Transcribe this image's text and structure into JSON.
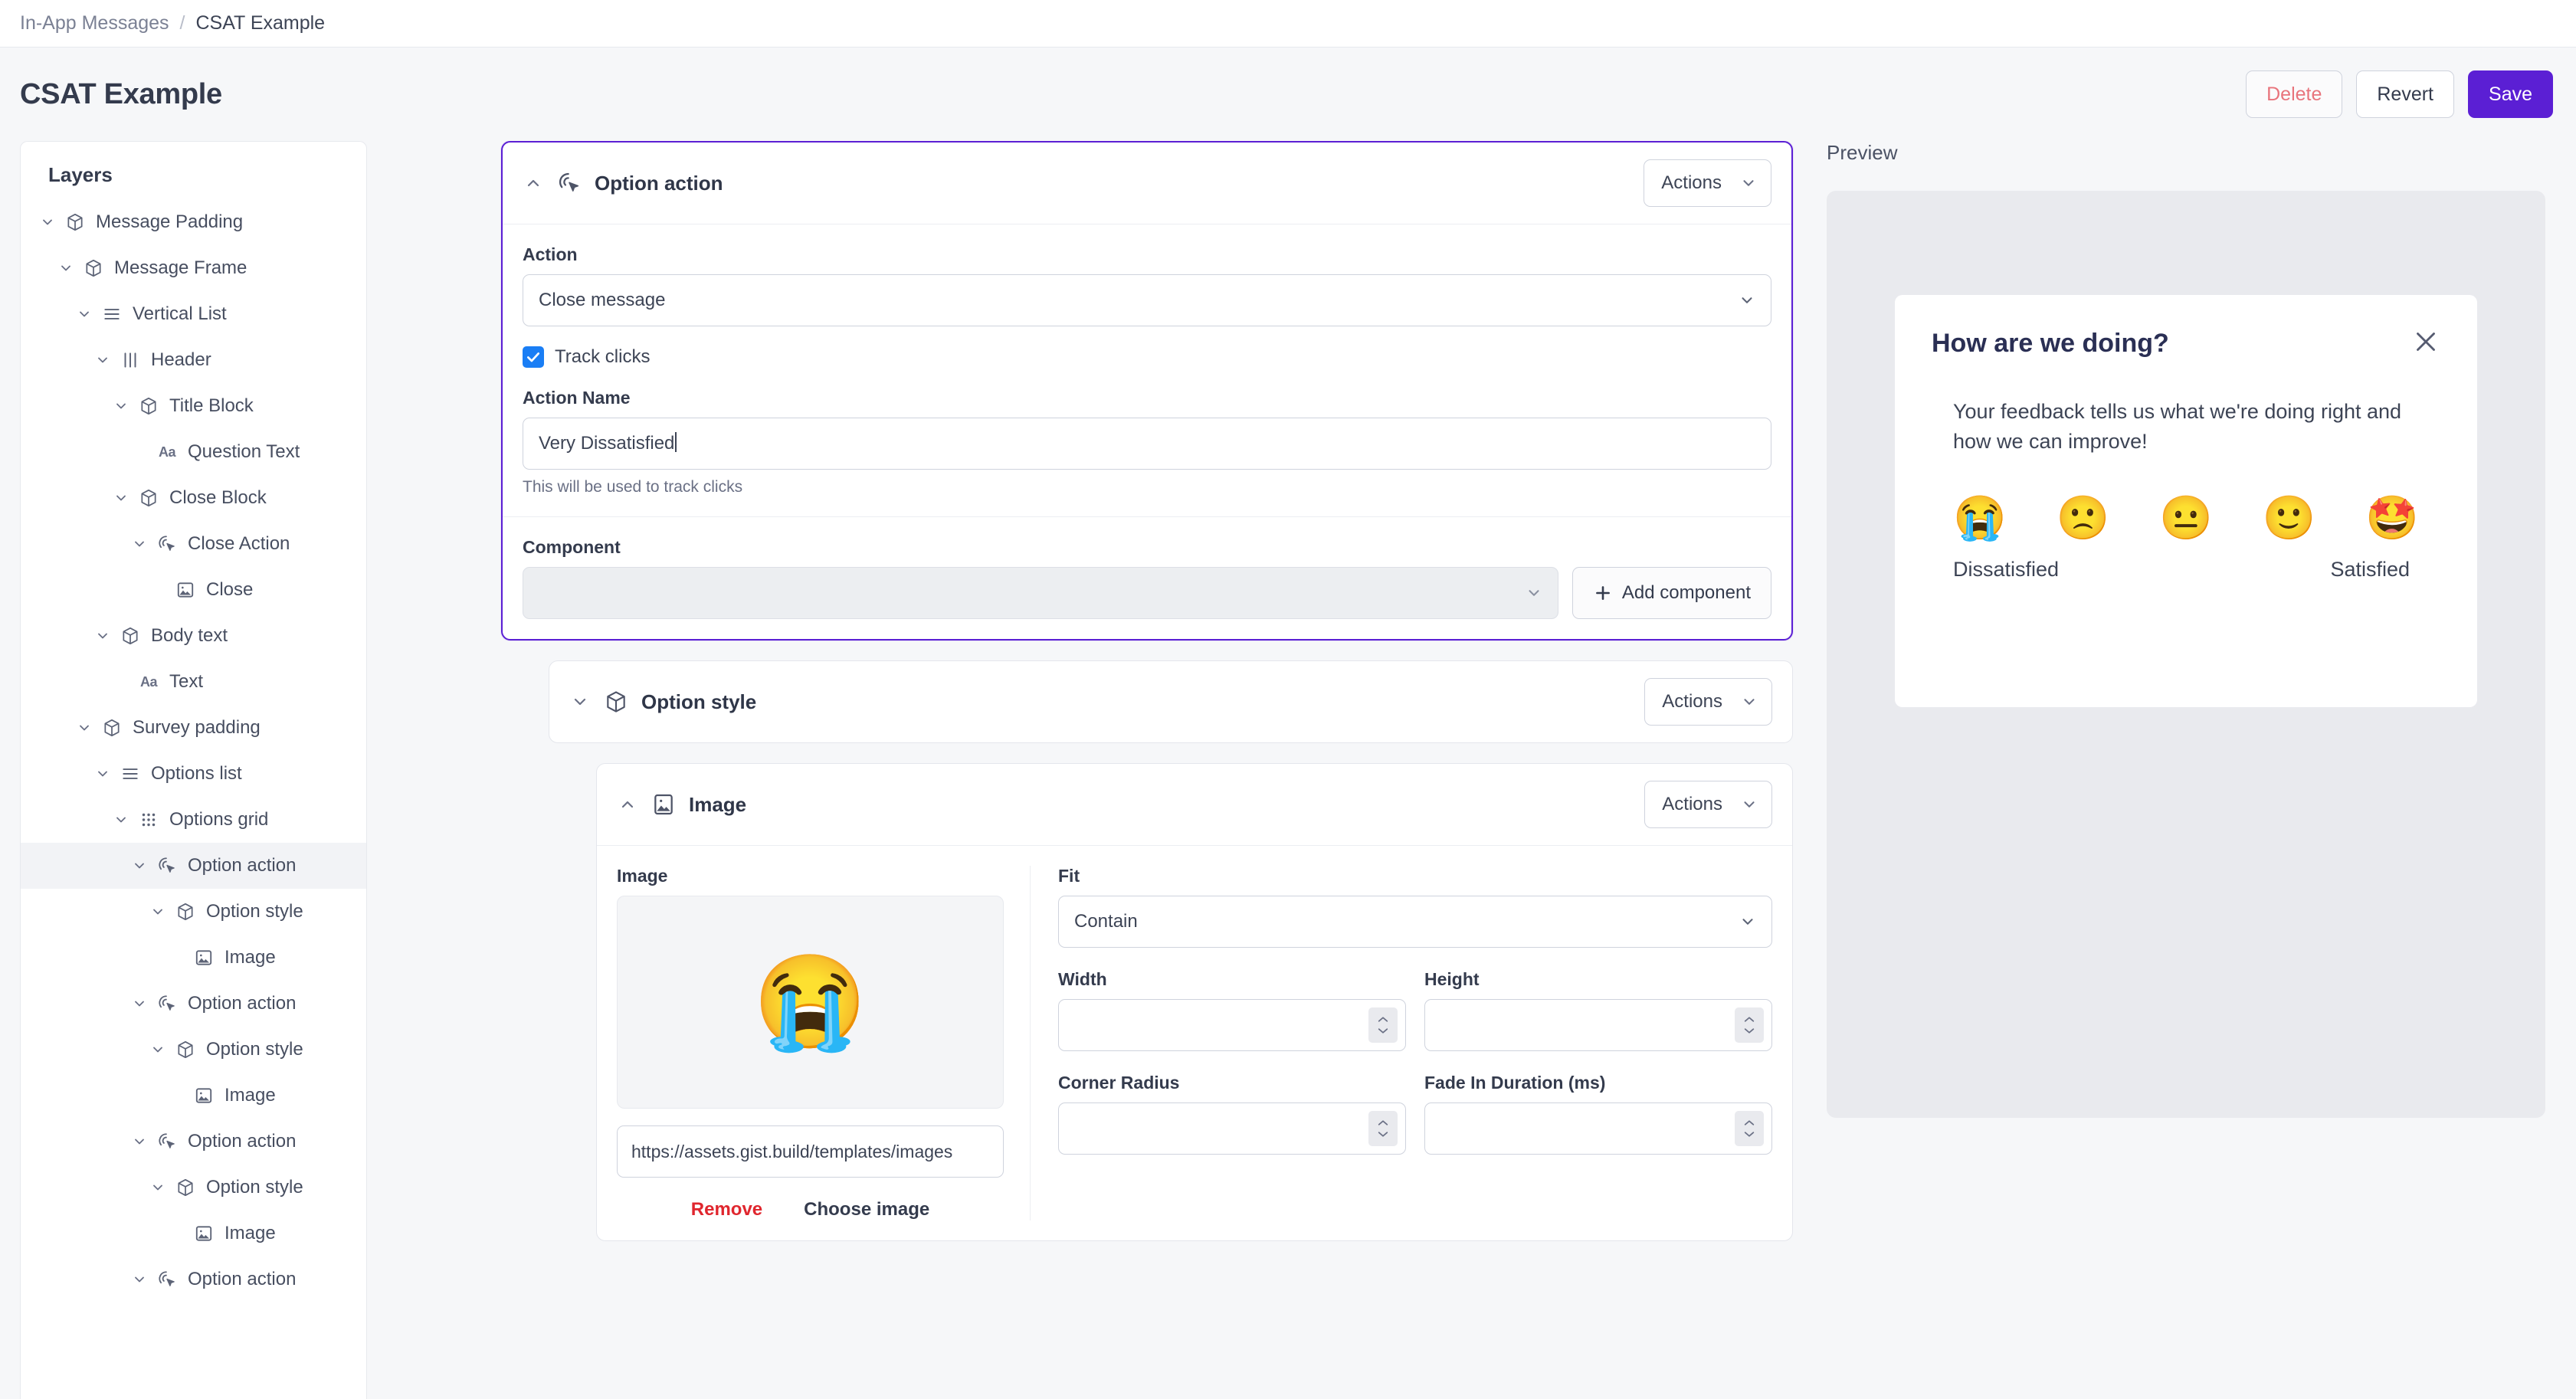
{
  "breadcrumb": {
    "parent": "In-App Messages",
    "separator": "/",
    "current": "CSAT Example"
  },
  "header": {
    "title": "CSAT Example",
    "delete_label": "Delete",
    "revert_label": "Revert",
    "save_label": "Save"
  },
  "colors": {
    "accent_purple": "#5b1fd4",
    "checkbox_blue": "#1a7ef5",
    "delete_red": "#e8747c",
    "remove_red": "#e0262e",
    "page_bg": "#f6f7f9",
    "preview_stage": "#e9eaee"
  },
  "layers": {
    "title": "Layers",
    "items": [
      {
        "label": "Message Padding",
        "depth": 0,
        "icon": "cube-icon",
        "chevron": "chevron-down-icon",
        "selected": false
      },
      {
        "label": "Message Frame",
        "depth": 1,
        "icon": "cube-icon",
        "chevron": "chevron-down-icon",
        "selected": false
      },
      {
        "label": "Vertical List",
        "depth": 2,
        "icon": "list-icon",
        "chevron": "chevron-down-icon",
        "selected": false
      },
      {
        "label": "Header",
        "depth": 3,
        "icon": "columns-icon",
        "chevron": "chevron-down-icon",
        "selected": false
      },
      {
        "label": "Title Block",
        "depth": 4,
        "icon": "cube-icon",
        "chevron": "chevron-down-icon",
        "selected": false
      },
      {
        "label": "Question Text",
        "depth": 5,
        "icon": "text-aa-icon",
        "chevron": "none",
        "selected": false
      },
      {
        "label": "Close Block",
        "depth": 4,
        "icon": "cube-icon",
        "chevron": "chevron-down-icon",
        "selected": false
      },
      {
        "label": "Close Action",
        "depth": 5,
        "icon": "cursor-click-icon",
        "chevron": "chevron-down-icon",
        "selected": false
      },
      {
        "label": "Close",
        "depth": 6,
        "icon": "image-icon",
        "chevron": "none",
        "selected": false
      },
      {
        "label": "Body text",
        "depth": 3,
        "icon": "cube-icon",
        "chevron": "chevron-down-icon",
        "selected": false
      },
      {
        "label": "Text",
        "depth": 4,
        "icon": "text-aa-icon",
        "chevron": "none",
        "selected": false
      },
      {
        "label": "Survey padding",
        "depth": 2,
        "icon": "cube-icon",
        "chevron": "chevron-down-icon",
        "selected": false
      },
      {
        "label": "Options list",
        "depth": 3,
        "icon": "list-icon",
        "chevron": "chevron-down-icon",
        "selected": false
      },
      {
        "label": "Options grid",
        "depth": 4,
        "icon": "grid-dots-icon",
        "chevron": "chevron-down-icon",
        "selected": false
      },
      {
        "label": "Option action",
        "depth": 5,
        "icon": "cursor-click-icon",
        "chevron": "chevron-down-icon",
        "selected": true
      },
      {
        "label": "Option style",
        "depth": 6,
        "icon": "cube-icon",
        "chevron": "chevron-down-icon",
        "selected": false
      },
      {
        "label": "Image",
        "depth": 7,
        "icon": "image-icon",
        "chevron": "none",
        "selected": false
      },
      {
        "label": "Option action",
        "depth": 5,
        "icon": "cursor-click-icon",
        "chevron": "chevron-down-icon",
        "selected": false
      },
      {
        "label": "Option style",
        "depth": 6,
        "icon": "cube-icon",
        "chevron": "chevron-down-icon",
        "selected": false
      },
      {
        "label": "Image",
        "depth": 7,
        "icon": "image-icon",
        "chevron": "none",
        "selected": false
      },
      {
        "label": "Option action",
        "depth": 5,
        "icon": "cursor-click-icon",
        "chevron": "chevron-down-icon",
        "selected": false
      },
      {
        "label": "Option style",
        "depth": 6,
        "icon": "cube-icon",
        "chevron": "chevron-down-icon",
        "selected": false
      },
      {
        "label": "Image",
        "depth": 7,
        "icon": "image-icon",
        "chevron": "none",
        "selected": false
      },
      {
        "label": "Option action",
        "depth": 5,
        "icon": "cursor-click-icon",
        "chevron": "chevron-down-icon",
        "selected": false
      }
    ]
  },
  "option_action_card": {
    "title": "Option action",
    "icon": "cursor-click-icon",
    "actions_label": "Actions",
    "collapse_state": "expanded",
    "action_field_label": "Action",
    "action_value": "Close message",
    "track_clicks_label": "Track clicks",
    "track_clicks_checked": true,
    "action_name_label": "Action Name",
    "action_name_value": "Very Dissatisfied",
    "action_name_help": "This will be used to track clicks",
    "component_label": "Component",
    "component_value": "",
    "add_component_label": "Add component"
  },
  "option_style_card": {
    "title": "Option style",
    "icon": "cube-icon",
    "actions_label": "Actions",
    "collapse_state": "collapsed"
  },
  "image_card": {
    "title": "Image",
    "icon": "image-icon",
    "actions_label": "Actions",
    "collapse_state": "expanded",
    "image_label": "Image",
    "image_emoji": "😭",
    "image_url": "https://assets.gist.build/templates/images",
    "remove_label": "Remove",
    "choose_image_label": "Choose image",
    "fit_label": "Fit",
    "fit_value": "Contain",
    "width_label": "Width",
    "width_value": "",
    "height_label": "Height",
    "height_value": "",
    "corner_radius_label": "Corner Radius",
    "corner_radius_value": "",
    "fade_in_label": "Fade In Duration (ms)",
    "fade_in_value": ""
  },
  "preview": {
    "label": "Preview",
    "message": {
      "title": "How are we doing?",
      "body": "Your feedback tells us what we're doing right and how we can improve!",
      "close_icon": "close-x-icon",
      "options": [
        {
          "emoji": "😭",
          "name": "loudly-crying-face"
        },
        {
          "emoji": "🙁",
          "name": "frowning-face"
        },
        {
          "emoji": "😐",
          "name": "neutral-face"
        },
        {
          "emoji": "🙂",
          "name": "slightly-smiling-face"
        },
        {
          "emoji": "🤩",
          "name": "star-struck-face"
        }
      ],
      "caption_left": "Dissatisfied",
      "caption_right": "Satisfied"
    }
  }
}
